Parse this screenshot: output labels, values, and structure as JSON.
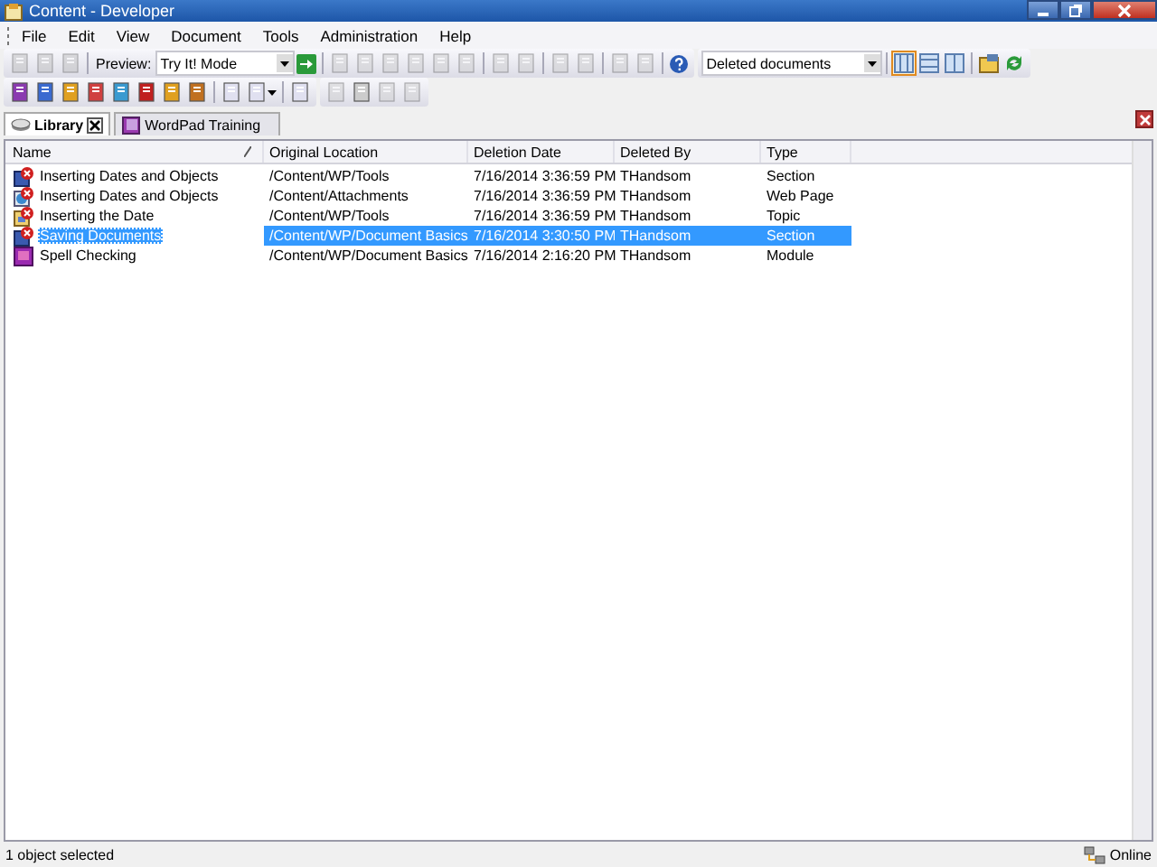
{
  "window": {
    "title": "Content - Developer"
  },
  "menu": [
    "File",
    "Edit",
    "View",
    "Document",
    "Tools",
    "Administration",
    "Help"
  ],
  "toolbar": {
    "preview_label": "Preview:",
    "preview_mode": "Try It! Mode",
    "view_filter": "Deleted documents"
  },
  "tabs": [
    {
      "label": "Library",
      "selected": true,
      "closable": true
    },
    {
      "label": "WordPad Training",
      "selected": false,
      "closable": false
    }
  ],
  "table": {
    "columns": [
      "Name",
      "Original Location",
      "Deletion Date",
      "Deleted By",
      "Type"
    ],
    "rows": [
      {
        "kind": "section",
        "selected": false,
        "cells": [
          "Inserting Dates and Objects",
          "/Content/WP/Tools",
          "7/16/2014 3:36:59 PM",
          "THandsom",
          "Section"
        ]
      },
      {
        "kind": "webpage",
        "selected": false,
        "cells": [
          "Inserting Dates and Objects",
          "/Content/Attachments",
          "7/16/2014 3:36:59 PM",
          "THandsom",
          "Web Page"
        ]
      },
      {
        "kind": "topic",
        "selected": false,
        "cells": [
          "Inserting the Date",
          "/Content/WP/Tools",
          "7/16/2014 3:36:59 PM",
          "THandsom",
          "Topic"
        ]
      },
      {
        "kind": "section",
        "selected": true,
        "cells": [
          "Saving Documents",
          "/Content/WP/Document Basics",
          "7/16/2014 3:30:50 PM",
          "THandsom",
          "Section"
        ]
      },
      {
        "kind": "module",
        "selected": false,
        "cells": [
          "Spell Checking",
          "/Content/WP/Document Basics",
          "7/16/2014 2:16:20 PM",
          "THandsom",
          "Module"
        ]
      }
    ]
  },
  "status_bar": {
    "message": "1 object selected",
    "connection": "Online"
  }
}
